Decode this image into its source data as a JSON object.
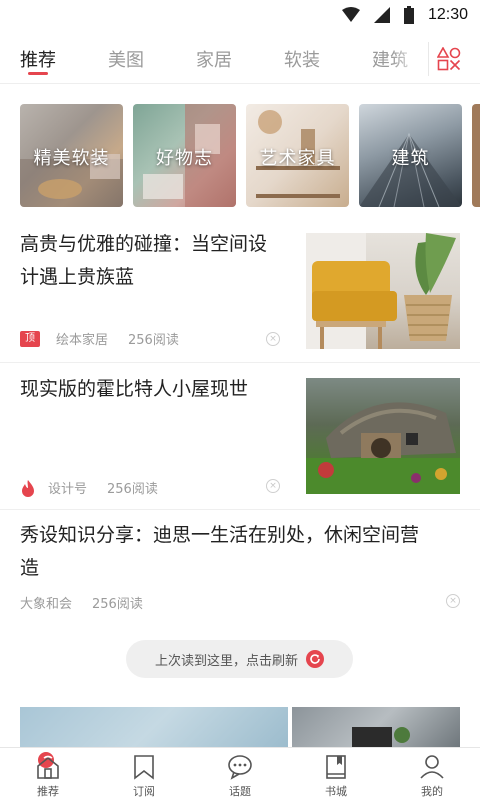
{
  "status_bar": {
    "time": "12:30",
    "icons": [
      "wifi-icon",
      "signal-icon",
      "battery-icon"
    ]
  },
  "tabs": [
    {
      "label": "推荐",
      "active": true
    },
    {
      "label": "美图"
    },
    {
      "label": "家居"
    },
    {
      "label": "软装"
    },
    {
      "label": "建筑"
    }
  ],
  "tabs_menu_icon": "category-grid-icon",
  "categories": [
    {
      "label": "精美软装"
    },
    {
      "label": "好物志"
    },
    {
      "label": "艺术家具"
    },
    {
      "label": "建筑"
    }
  ],
  "articles": [
    {
      "title_line1": "高贵与优雅的碰撞：当空间设",
      "title_line2": "计遇上贵族蓝",
      "badge": "顶",
      "source": "绘本家居",
      "reads": "256阅读"
    },
    {
      "title_line1": "现实版的霍比特人小屋现世",
      "badge_icon": "fire-icon",
      "source": "设计号",
      "reads": "256阅读"
    },
    {
      "title_line1": "秀设知识分享：迪思一生活在别处，休闲空间营",
      "title_line2": "造",
      "source": "大象和会",
      "reads": "256阅读"
    }
  ],
  "refresh_banner": {
    "text": "上次读到这里，点击刷新",
    "icon": "refresh-icon"
  },
  "bottom_nav": [
    {
      "label": "推荐",
      "icon": "home-icon",
      "active": true
    },
    {
      "label": "订阅",
      "icon": "bookmark-icon"
    },
    {
      "label": "话题",
      "icon": "chat-bubble-icon"
    },
    {
      "label": "书城",
      "icon": "book-icon"
    },
    {
      "label": "我的",
      "icon": "user-icon"
    }
  ],
  "colors": {
    "accent": "#e5454e",
    "text": "#222222",
    "muted": "#9b9b9b",
    "divider": "#eeeeee"
  }
}
